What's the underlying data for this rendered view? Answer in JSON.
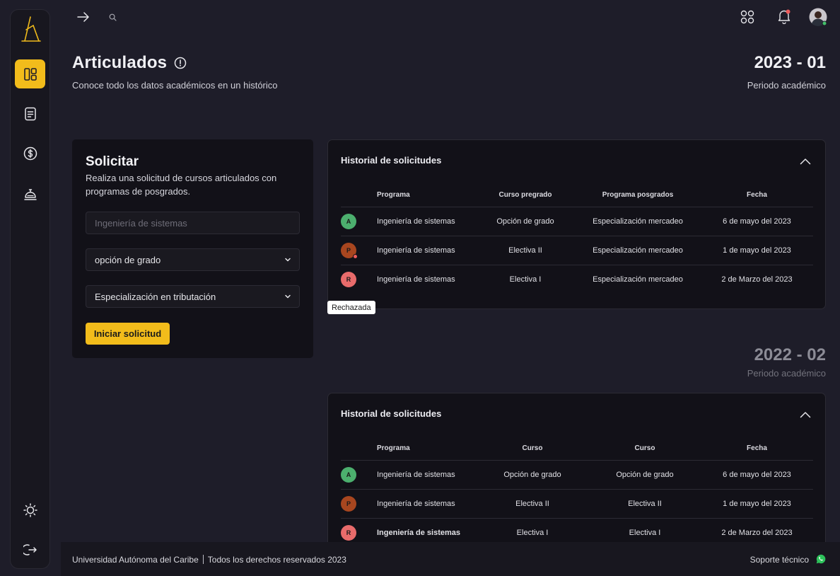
{
  "header": {
    "title": "Articulados",
    "subtitle": "Conoce todo los datos académicos en un histórico",
    "period": "2023 - 01",
    "period_label": "Periodo académico"
  },
  "sidebar": {
    "items": [
      {
        "icon": "dashboard-icon",
        "active": true
      },
      {
        "icon": "document-icon",
        "active": false
      },
      {
        "icon": "dollar-icon",
        "active": false
      },
      {
        "icon": "bell-service-icon",
        "active": false
      }
    ],
    "bottom": [
      {
        "icon": "sun-icon"
      },
      {
        "icon": "logout-icon"
      }
    ]
  },
  "request": {
    "title": "Solicitar",
    "description": "Realiza una solicitud de cursos articulados con programas de posgrados.",
    "program_placeholder": "Ingeniería de sistemas",
    "course_value": "opción de grado",
    "postgrad_value": "Especialización en tributación",
    "submit_label": "Iniciar solicitud"
  },
  "history_1": {
    "title": "Historial de solicitudes",
    "columns": [
      "Programa",
      "Curso pregrado",
      "Programa posgrados",
      "Fecha"
    ],
    "rows": [
      {
        "status": "A",
        "color": "#4caf6e",
        "programa": "Ingeniería de sistemas",
        "curso": "Opción de grado",
        "posgrado": "Especialización mercadeo",
        "fecha": "6 de mayo del 2023"
      },
      {
        "status": "P",
        "color": "#a8461f",
        "programa": "Ingeniería de sistemas",
        "curso": "Electiva II",
        "posgrado": "Especialización mercadeo",
        "fecha": "1 de mayo del 2023"
      },
      {
        "status": "R",
        "color": "#e86b6b",
        "programa": "Ingeniería de sistemas",
        "curso": "Electiva I",
        "posgrado": "Especialización mercadeo",
        "fecha": "2 de Marzo del 2023"
      }
    ],
    "tooltip": "Rechazada"
  },
  "period_2": {
    "period": "2022 - 02",
    "period_label": "Periodo académico"
  },
  "history_2": {
    "title": "Historial de solicitudes",
    "columns": [
      "Programa",
      "Curso",
      "Curso",
      "Fecha"
    ],
    "rows": [
      {
        "status": "A",
        "color": "#4caf6e",
        "programa": "Ingeniería de sistemas",
        "curso": "Opción de grado",
        "curso2": "Opción de grado",
        "fecha": "6 de mayo del 2023"
      },
      {
        "status": "P",
        "color": "#a8461f",
        "programa": "Ingeniería de sistemas",
        "curso": "Electiva II",
        "curso2": "Electiva II",
        "fecha": "1 de mayo del 2023"
      },
      {
        "status": "R",
        "color": "#e86b6b",
        "programa": "Ingeniería de sistemas",
        "curso": "Electiva I",
        "curso2": "Electiva I",
        "fecha": "2 de Marzo del 2023"
      }
    ]
  },
  "footer": {
    "university": "Universidad Autónoma del Caribe",
    "rights": "Todos los derechos reservados  2023",
    "support": "Soporte técnico"
  },
  "colors": {
    "accent": "#f2bc1b",
    "background": "#1e1d29",
    "card": "#121118"
  }
}
